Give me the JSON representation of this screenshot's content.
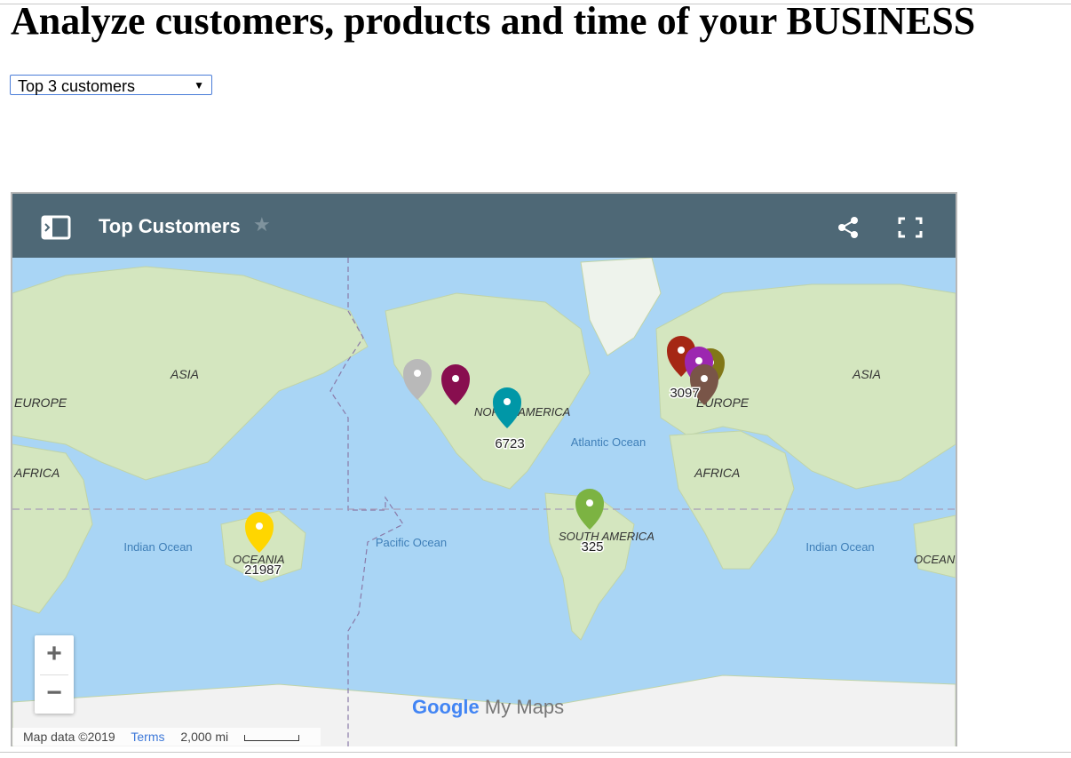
{
  "page": {
    "title": "Analyze customers, products and time of your BUSINESS"
  },
  "filter": {
    "selected": "Top 3 customers",
    "arrow": "▼"
  },
  "map": {
    "title": "Top Customers",
    "star": "★",
    "icons": [
      "panel-toggle-icon",
      "star-icon",
      "share-icon",
      "fullscreen-icon"
    ],
    "continent_labels": [
      "ASIA",
      "EUROPE",
      "AFRICA",
      "NORTH AMERICA",
      "SOUTH AMERICA",
      "EUROPE",
      "AFRICA",
      "ASIA",
      "OCEANIA",
      "OCEANIA"
    ],
    "ocean_labels": [
      "Indian Ocean",
      "Pacific Ocean",
      "Atlantic Ocean",
      "Indian Ocean"
    ],
    "marker_values": {
      "north_america": "6723",
      "europe": "3097",
      "south_america": "325",
      "oceania": "21987"
    },
    "marker_colors": {
      "grey": "#b9b9b9",
      "maroon": "#880e4f",
      "teal": "#0097a7",
      "red": "#a52714",
      "purple": "#9c27b0",
      "olive": "#817717",
      "brown": "#795548",
      "green": "#7cb342",
      "yellow": "#ffd600"
    },
    "zoom": {
      "in": "+",
      "out": "−"
    },
    "footer": {
      "attribution": "Map data ©2019",
      "terms": "Terms",
      "scale": "2,000 mi"
    },
    "brand": {
      "google": "Google",
      "mymaps": "My Maps"
    }
  }
}
